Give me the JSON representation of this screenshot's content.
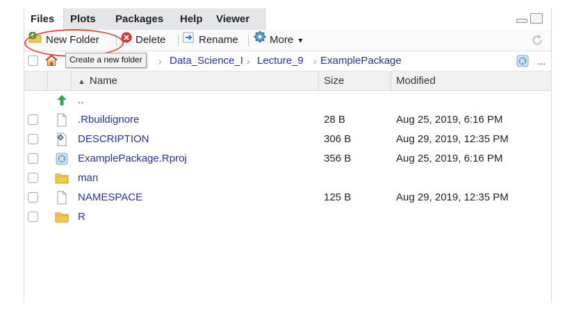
{
  "tabs": [
    {
      "label": "Files",
      "active": true
    },
    {
      "label": "Plots",
      "active": false
    },
    {
      "label": "Packages",
      "active": false
    },
    {
      "label": "Help",
      "active": false
    },
    {
      "label": "Viewer",
      "active": false
    }
  ],
  "toolbar": {
    "new_folder_label": "New Folder",
    "delete_label": "Delete",
    "rename_label": "Rename",
    "more_label": "More",
    "more_caret": "▾",
    "tooltip": "Create a new folder"
  },
  "breadcrumb": {
    "items": [
      "Data_Science_I",
      "Lecture_9",
      "ExamplePackage"
    ],
    "separator": "›",
    "more": "..."
  },
  "columns": {
    "name": "Name",
    "size": "Size",
    "modified": "Modified",
    "sort_indicator": "▲"
  },
  "files": [
    {
      "name": "..",
      "size": "",
      "modified": "",
      "icon": "up-arrow-icon",
      "checkbox": false
    },
    {
      "name": ".Rbuildignore",
      "size": "28 B",
      "modified": "Aug 25, 2019, 6:16 PM",
      "icon": "document-icon",
      "checkbox": true
    },
    {
      "name": "DESCRIPTION",
      "size": "306 B",
      "modified": "Aug 29, 2019, 12:35 PM",
      "icon": "gear-document-icon",
      "checkbox": true
    },
    {
      "name": "ExamplePackage.Rproj",
      "size": "356 B",
      "modified": "Aug 25, 2019, 6:16 PM",
      "icon": "rproj-icon",
      "checkbox": true
    },
    {
      "name": "man",
      "size": "",
      "modified": "",
      "icon": "folder-icon",
      "checkbox": true
    },
    {
      "name": "NAMESPACE",
      "size": "125 B",
      "modified": "Aug 29, 2019, 12:35 PM",
      "icon": "document-icon",
      "checkbox": true
    },
    {
      "name": "R",
      "size": "",
      "modified": "",
      "icon": "folder-icon",
      "checkbox": true
    }
  ],
  "colors": {
    "link": "#2330a8",
    "highlight_circle": "#e64a40",
    "folder": "#f3c84a",
    "up_arrow": "#34a853"
  }
}
